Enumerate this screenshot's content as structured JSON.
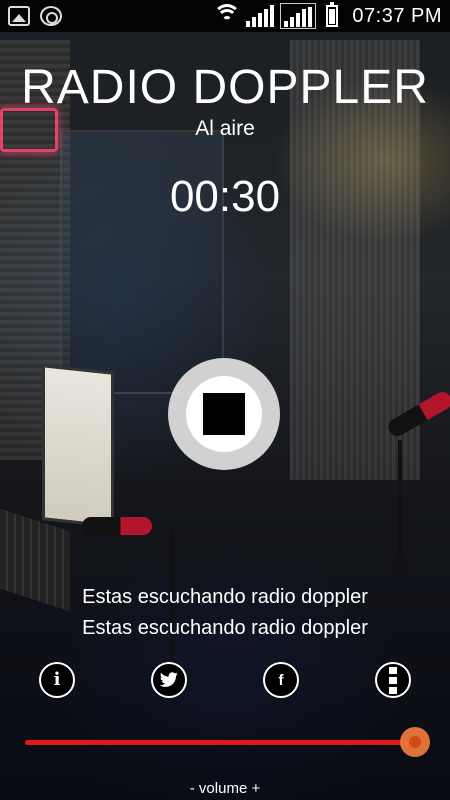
{
  "status_bar": {
    "time": "07:37 PM",
    "notifications": [
      "gallery-icon",
      "app-notification-icon"
    ],
    "indicators": [
      "wifi-icon",
      "signal-icon",
      "signal-icon",
      "battery-icon"
    ]
  },
  "player": {
    "station_name": "RADIO DOPPLER",
    "status": "Al aire",
    "elapsed": "00:30",
    "control": "stop-icon"
  },
  "messages": [
    "Estas escuchando radio doppler",
    "Estas escuchando radio doppler"
  ],
  "social": [
    "info-icon",
    "twitter-icon",
    "facebook-icon",
    "more-icon"
  ],
  "volume": {
    "label": "- volume +",
    "level": 1.0
  },
  "colors": {
    "accent": "#e01818",
    "thumb": "#eb783c"
  }
}
